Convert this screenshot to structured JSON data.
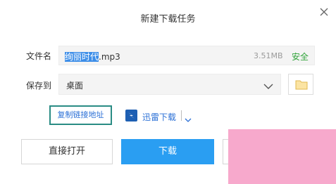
{
  "dialog": {
    "title": "新建下载任务",
    "close_icon": "close-icon"
  },
  "file": {
    "label": "文件名",
    "name_selected": "绚丽时代",
    "name_rest": ".mp3",
    "size": "3.51MB",
    "safe": "安全"
  },
  "save": {
    "label": "保存到",
    "path": "桌面",
    "dropdown_icon": "chevron-down-icon",
    "folder_icon": "folder-icon"
  },
  "links": {
    "copy_link": "复制链接地址",
    "xunlei_label": "迅雷下载",
    "xunlei_icon": "xunlei-logo-icon"
  },
  "buttons": {
    "open_direct": "直接打开",
    "download": "下载"
  },
  "colors": {
    "accent": "#2a9ef2",
    "safe": "#31a43a",
    "link": "#2a6fd6",
    "highlight_border": "#2a8c84",
    "selection": "#3d8ee8"
  }
}
